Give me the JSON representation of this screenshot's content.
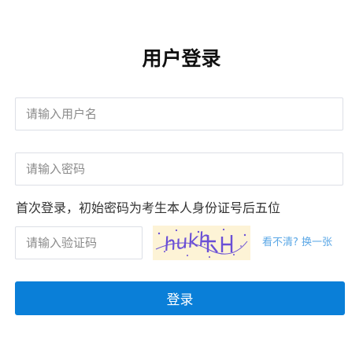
{
  "title": "用户登录",
  "username": {
    "placeholder": "请输入用户名",
    "value": ""
  },
  "password": {
    "placeholder": "请输入密码",
    "value": ""
  },
  "hint": "首次登录，初始密码为考生本人身份证号后五位",
  "captcha": {
    "placeholder": "请输入验证码",
    "value": "",
    "image_text": "hukh",
    "refresh_label": "看不清? 换一张"
  },
  "login_button": "登录",
  "colors": {
    "accent": "#0a7fd8",
    "link": "#5aa7e6",
    "captcha_bg": "#fdf3d6",
    "captcha_glyph": "#6a4fd6"
  }
}
